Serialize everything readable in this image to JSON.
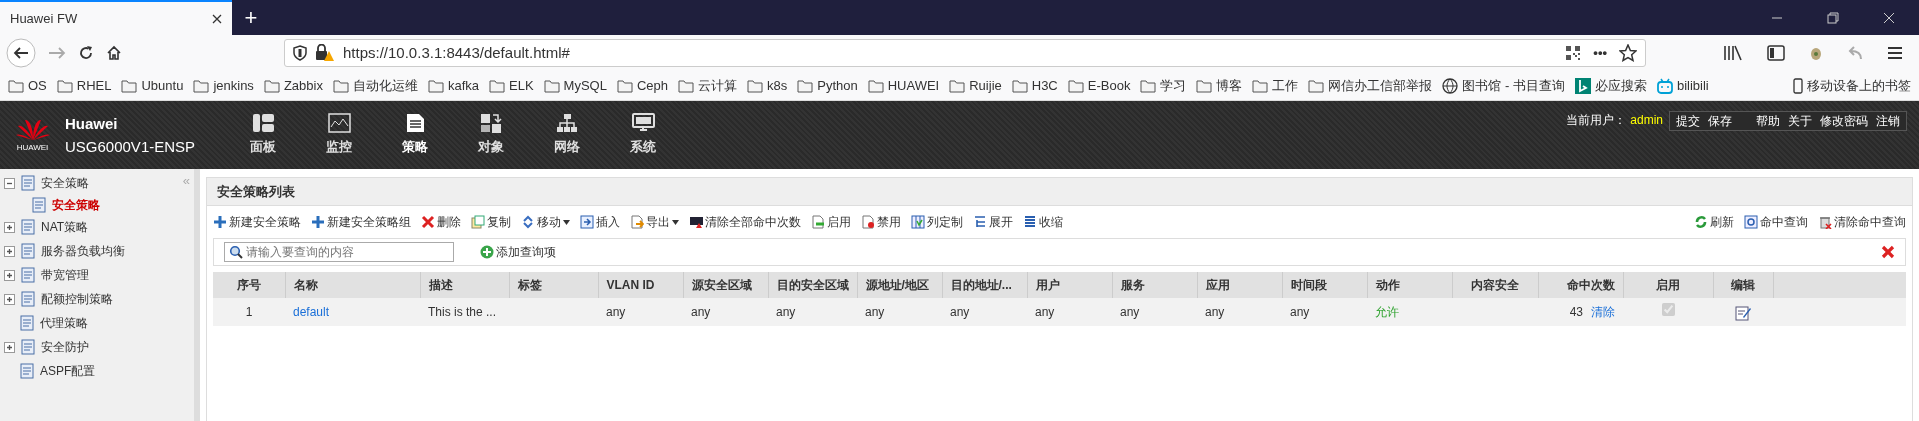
{
  "browser": {
    "tab_title": "Huawei FW",
    "new_tab": "+",
    "url": "https://10.0.3.1:8443/default.html#",
    "more": "•••",
    "bookmarks": [
      {
        "label": "OS",
        "kind": "folder"
      },
      {
        "label": "RHEL",
        "kind": "folder"
      },
      {
        "label": "Ubuntu",
        "kind": "folder"
      },
      {
        "label": "jenkins",
        "kind": "folder"
      },
      {
        "label": "Zabbix",
        "kind": "folder"
      },
      {
        "label": "自动化运维",
        "kind": "folder"
      },
      {
        "label": "kafka",
        "kind": "folder"
      },
      {
        "label": "ELK",
        "kind": "folder"
      },
      {
        "label": "MySQL",
        "kind": "folder"
      },
      {
        "label": "Ceph",
        "kind": "folder"
      },
      {
        "label": "云计算",
        "kind": "folder"
      },
      {
        "label": "k8s",
        "kind": "folder"
      },
      {
        "label": "Python",
        "kind": "folder"
      },
      {
        "label": "HUAWEI",
        "kind": "folder"
      },
      {
        "label": "Ruijie",
        "kind": "folder"
      },
      {
        "label": "H3C",
        "kind": "folder"
      },
      {
        "label": "E-Book",
        "kind": "folder"
      },
      {
        "label": "学习",
        "kind": "folder"
      },
      {
        "label": "博客",
        "kind": "folder"
      },
      {
        "label": "工作",
        "kind": "folder"
      },
      {
        "label": "网信办工信部举报",
        "kind": "folder"
      },
      {
        "label": "图书馆 - 书目查询",
        "kind": "globe"
      },
      {
        "label": "必应搜索",
        "kind": "bing"
      },
      {
        "label": "bilibili",
        "kind": "bili"
      }
    ],
    "mobile_bookmarks": "移动设备上的书签"
  },
  "header": {
    "logo_text": "HUAWEI",
    "brand": "Huawei",
    "model": "USG6000V1-ENSP",
    "nav": [
      {
        "label": "面板",
        "selected": false
      },
      {
        "label": "监控",
        "selected": false
      },
      {
        "label": "策略",
        "selected": true
      },
      {
        "label": "对象",
        "selected": false
      },
      {
        "label": "网络",
        "selected": false
      },
      {
        "label": "系统",
        "selected": false
      }
    ],
    "user_label": "当前用户：",
    "user": "admin",
    "links": [
      [
        "提交",
        "保存"
      ],
      [
        "帮助",
        "关于",
        "修改密码",
        "注销"
      ]
    ]
  },
  "sidebar": {
    "collapse": "«",
    "items": [
      {
        "label": "安全策略",
        "kind": "group",
        "expanded": true,
        "selected": false,
        "children": [
          {
            "label": "安全策略",
            "selected": true
          }
        ]
      },
      {
        "label": "NAT策略",
        "kind": "group",
        "expanded": false,
        "selected": false
      },
      {
        "label": "服务器负载均衡",
        "kind": "group",
        "expanded": false,
        "selected": false
      },
      {
        "label": "带宽管理",
        "kind": "group",
        "expanded": false,
        "selected": false
      },
      {
        "label": "配额控制策略",
        "kind": "group",
        "expanded": false,
        "selected": false
      },
      {
        "label": "代理策略",
        "kind": "leaf",
        "selected": false
      },
      {
        "label": "安全防护",
        "kind": "group",
        "expanded": false,
        "selected": false
      },
      {
        "label": "ASPF配置",
        "kind": "leaf",
        "selected": false
      }
    ]
  },
  "panel": {
    "title": "安全策略列表",
    "toolbar": [
      {
        "label": "新建安全策略",
        "dropdown": false
      },
      {
        "label": "新建安全策略组",
        "dropdown": false
      },
      {
        "label": "删除",
        "dropdown": false
      },
      {
        "label": "复制",
        "dropdown": false
      },
      {
        "label": "移动",
        "dropdown": true
      },
      {
        "label": "插入",
        "dropdown": false
      },
      {
        "label": "导出",
        "dropdown": true
      },
      {
        "label": "清除全部命中次数",
        "dropdown": false
      },
      {
        "label": "启用",
        "dropdown": false
      },
      {
        "label": "禁用",
        "dropdown": false
      },
      {
        "label": "列定制",
        "dropdown": false
      },
      {
        "label": "展开",
        "dropdown": false
      },
      {
        "label": "收缩",
        "dropdown": false
      }
    ],
    "toolbar_right": [
      "刷新",
      "命中查询",
      "清除命中查询"
    ],
    "search": {
      "placeholder": "请输入要查询的内容"
    },
    "add_filter": "添加查询项",
    "table": {
      "columns": [
        "序号",
        "名称",
        "描述",
        "标签",
        "VLAN ID",
        "源安全区域",
        "目的安全区域",
        "源地址/地区",
        "目的地址/...",
        "用户",
        "服务",
        "应用",
        "时间段",
        "动作",
        "内容安全",
        "命中次数",
        "启用",
        "编辑"
      ],
      "rows": [
        {
          "cells": [
            "1",
            "default",
            "This is the ...",
            null,
            "any",
            "any",
            "any",
            "any",
            "any",
            "any",
            "any",
            "any",
            "any",
            "允许",
            null
          ],
          "hits": "43",
          "clear": "清除",
          "enabled": true
        }
      ]
    }
  }
}
